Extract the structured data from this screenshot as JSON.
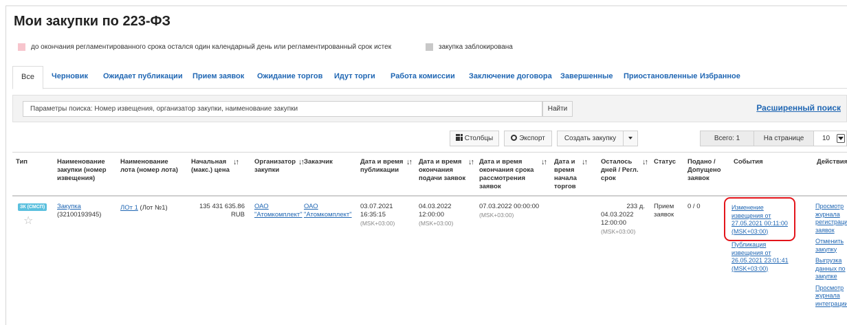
{
  "page": {
    "title": "Мои закупки по 223-ФЗ"
  },
  "legend": {
    "deadline_text": "до окончания регламентированного срока остался один календарный день или регламентированный срок истек",
    "deadline_color": "#f7c5cd",
    "blocked_text": "закупка заблокирована",
    "blocked_color": "#c8c8c8"
  },
  "tabs": [
    {
      "label": "Все"
    },
    {
      "label": "Черновик"
    },
    {
      "label": "Ожидает публикации"
    },
    {
      "label": "Прием заявок"
    },
    {
      "label": "Ожидание торгов"
    },
    {
      "label": "Идут торги"
    },
    {
      "label": "Работа комиссии"
    },
    {
      "label": "Заключение договора"
    },
    {
      "label": "Завершенные"
    },
    {
      "label": "Приостановленные"
    },
    {
      "label": "Избранное"
    }
  ],
  "search": {
    "value": "Параметры поиска: Номер извещения, организатор закупки, наименование закупки",
    "find_label": "Найти",
    "advanced_label": "Расширенный поиск"
  },
  "toolbar": {
    "columns_label": "Столбцы",
    "export_label": "Экспорт",
    "create_label": "Создать закупку",
    "total_label": "Всего: 1",
    "per_page_label": "На странице",
    "per_page_value": "10"
  },
  "table": {
    "headers": {
      "type": "Тип",
      "purchase_name": [
        "Наименование",
        "закупки (номер",
        "извещения)"
      ],
      "lot_name": [
        "Наименование",
        "лота (номер лота)"
      ],
      "price": [
        "Начальная",
        "(макс.) цена"
      ],
      "organizer": [
        "Организатор",
        "закупки"
      ],
      "customer": "Заказчик",
      "pub_date": [
        "Дата и время",
        "публикации"
      ],
      "end_date": [
        "Дата и время",
        "окончания",
        "подачи заявок"
      ],
      "review_date": [
        "Дата и время",
        "окончания срока",
        "рассмотрения",
        "заявок"
      ],
      "auction_date": [
        "Дата и",
        "время",
        "начала",
        "торгов"
      ],
      "remaining": [
        "Осталось",
        "дней / Регл.",
        "срок"
      ],
      "status": "Статус",
      "submitted": [
        "Подано /",
        "Допущено",
        "заявок"
      ],
      "events": "События",
      "actions": "Действия"
    },
    "row": {
      "type_badge": "ЗК (СМСП)",
      "purchase_link": "Закупка",
      "purchase_number": "(32100193945)",
      "lot_link": "ЛОт 1",
      "lot_number": " (Лот №1)",
      "price": "135 431 635.86",
      "currency": "RUB",
      "organizer": [
        "ОАО",
        "\"Атомкомплект\""
      ],
      "customer": [
        "ОАО",
        "\"Атомкомплект\""
      ],
      "pub_date": "03.07.2021",
      "pub_time": "16:35:15",
      "pub_tz": "(MSK+03:00)",
      "end_date": "04.03.2022",
      "end_time": "12:00:00",
      "end_tz": "(MSK+03:00)",
      "review_datetime": "07.03.2022 00:00:00",
      "review_tz": "(MSK+03:00)",
      "remaining_days": "233 д.",
      "remaining_date": "04.03.2022",
      "remaining_time": "12:00:00",
      "remaining_tz": "(MSK+03:00)",
      "status": [
        "Прием",
        "заявок"
      ],
      "submitted": "0 / 0",
      "events": [
        [
          "Изменение",
          "извещения от",
          "27.05.2021 00:11:00",
          "(MSK+03:00)"
        ],
        [
          "Публикация",
          "извещения от",
          "26.05.2021 23:01:41",
          "(MSK+03:00)"
        ]
      ],
      "actions": [
        [
          "Просмотр",
          "журнала",
          "регистрации",
          "заявок"
        ],
        [
          "Отменить",
          "закупку"
        ],
        [
          "Выгрузка",
          "данных по",
          "закупке"
        ],
        [
          "Просмотр",
          "журнала",
          "интеграции"
        ]
      ]
    }
  }
}
